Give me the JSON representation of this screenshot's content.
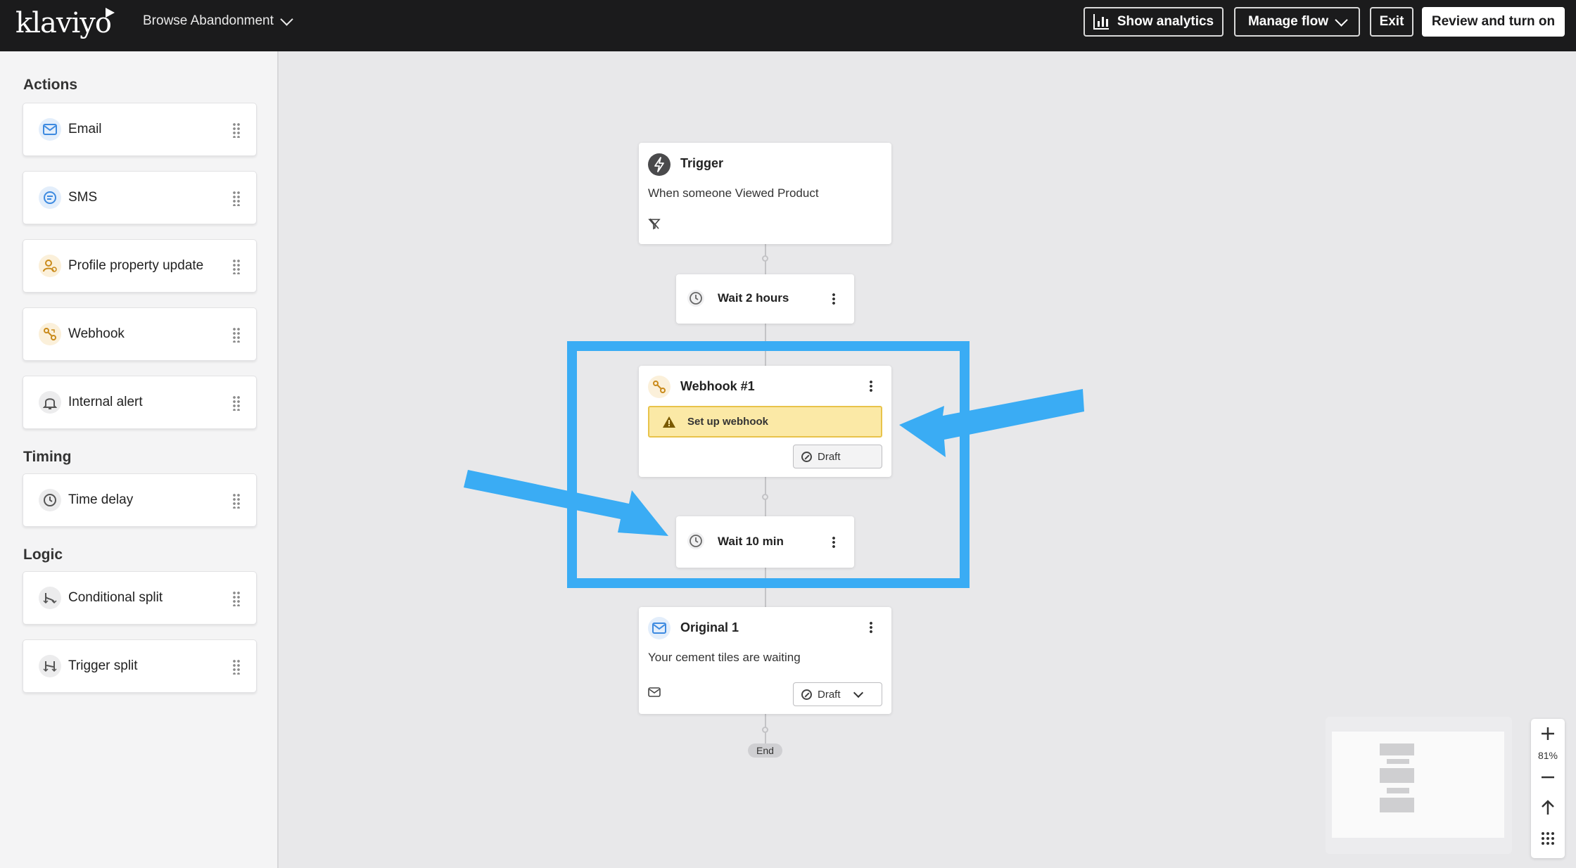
{
  "topbar": {
    "logo": "klaviyo",
    "flow_name": "Browse Abandonment",
    "show_analytics": "Show analytics",
    "manage_flow": "Manage flow",
    "exit": "Exit",
    "review": "Review and turn on"
  },
  "sidebar": {
    "actions_title": "Actions",
    "actions": [
      {
        "label": "Email",
        "icon": "email-icon"
      },
      {
        "label": "SMS",
        "icon": "sms-icon"
      },
      {
        "label": "Profile property update",
        "icon": "profile-icon"
      },
      {
        "label": "Webhook",
        "icon": "webhook-icon"
      },
      {
        "label": "Internal alert",
        "icon": "bell-icon"
      }
    ],
    "timing_title": "Timing",
    "timing": [
      {
        "label": "Time delay",
        "icon": "clock-icon"
      }
    ],
    "logic_title": "Logic",
    "logic": [
      {
        "label": "Conditional split",
        "icon": "split-icon"
      },
      {
        "label": "Trigger split",
        "icon": "trigger-split-icon"
      }
    ]
  },
  "flow": {
    "trigger": {
      "title": "Trigger",
      "text": "When someone Viewed Product"
    },
    "wait1": {
      "label": "Wait 2 hours"
    },
    "webhook": {
      "title": "Webhook #1",
      "warning": "Set up webhook",
      "status": "Draft"
    },
    "wait2": {
      "label": "Wait 10 min"
    },
    "email": {
      "title": "Original 1",
      "text": "Your cement tiles are waiting",
      "status": "Draft"
    },
    "end": "End"
  },
  "zoom": {
    "level": "81%"
  },
  "colors": {
    "highlight": "#3aacf4",
    "warning_bg": "#fbe9a6",
    "topbar": "#1b1b1c"
  }
}
